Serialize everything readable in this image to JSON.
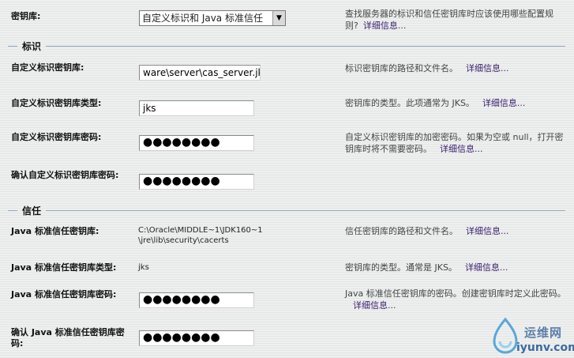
{
  "keystores": {
    "label": "密钥库:",
    "selected": "自定义标识和 Java 标准信任",
    "desc": "查找服务器的标识和信任密钥库时应该使用哪些配置规则?",
    "more": "详细信息..."
  },
  "identity_section": {
    "title": "标识"
  },
  "trust_section": {
    "title": "信任"
  },
  "identity": {
    "path": {
      "label": "自定义标识密钥库:",
      "value": "ware\\server\\cas_server.jks",
      "desc": "标识密钥库的路径和文件名。",
      "more": "详细信息..."
    },
    "type": {
      "label": "自定义标识密钥库类型:",
      "value": "jks",
      "desc": "密钥库的类型。此项通常为 JKS。",
      "more": "详细信息..."
    },
    "password": {
      "label": "自定义标识密钥库密码:",
      "value": "●●●●●●●●",
      "desc": "自定义标识密钥库的加密密码。如果为空或 null，打开密钥库时将不需要密码。",
      "more": "详细信息..."
    },
    "confirm": {
      "label": "确认自定义标识密钥库密码:",
      "value": "●●●●●●●●"
    }
  },
  "trust": {
    "path": {
      "label": "Java 标准信任密钥库:",
      "value_line1": "C:\\Oracle\\MIDDLE~1\\JDK160~1",
      "value_line2": "\\jre\\lib\\security\\cacerts",
      "desc": "信任密钥库的路径和文件名。",
      "more": "详细信息..."
    },
    "type": {
      "label": "Java 标准信任密钥库类型:",
      "value": "jks",
      "desc": "密钥库的类型。通常是 JKS。",
      "more": "详细信息..."
    },
    "password": {
      "label": "Java 标准信任密钥库密码:",
      "value": "●●●●●●●●",
      "desc": "Java 标准信任密钥库的密码。创建密钥库时定义此密码。",
      "more": "详细信息..."
    },
    "confirm": {
      "label": "确认 Java 标准信任密钥库密码:",
      "value": "●●●●●●●●"
    }
  },
  "watermark": {
    "name": "运维网",
    "url": "iyunv.com"
  }
}
